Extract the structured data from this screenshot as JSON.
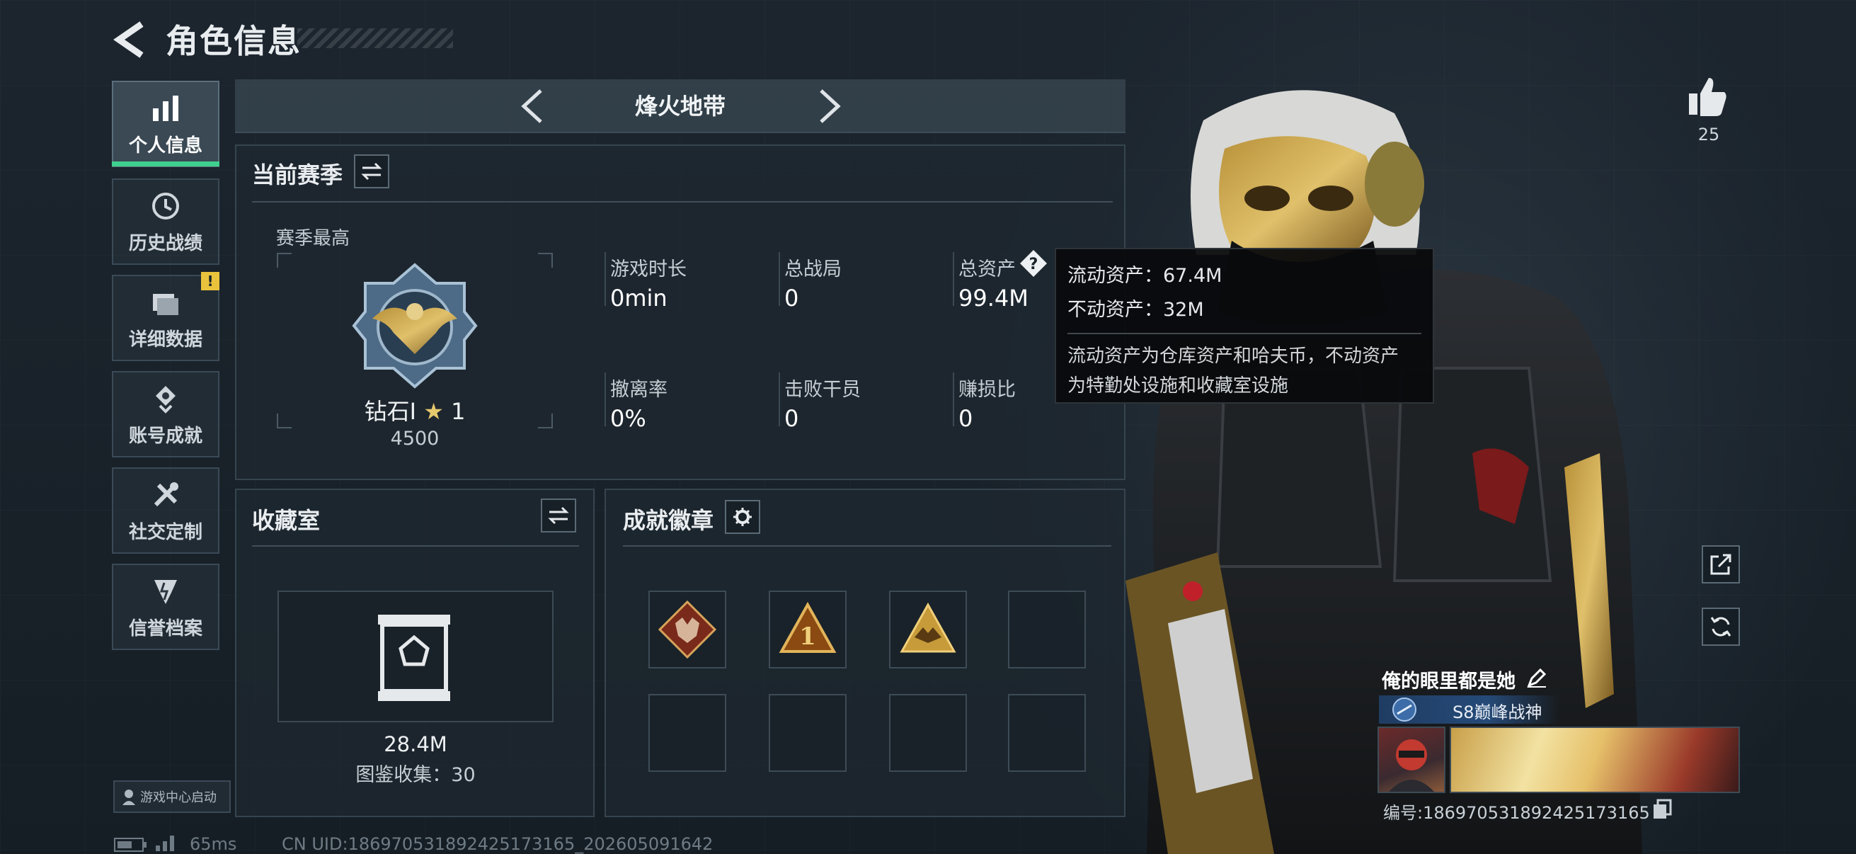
{
  "header": {
    "title": "角色信息"
  },
  "sidebar": {
    "items": [
      {
        "label": "个人信息",
        "icon": "bar-chart-icon",
        "active": true
      },
      {
        "label": "历史战绩",
        "icon": "history-clock-icon"
      },
      {
        "label": "详细数据",
        "icon": "folder-icon",
        "alert": "!"
      },
      {
        "label": "账号成就",
        "icon": "achievement-icon"
      },
      {
        "label": "社交定制",
        "icon": "tools-icon"
      },
      {
        "label": "信誉档案",
        "icon": "credit-icon"
      }
    ],
    "launch_label": "游戏中心启动"
  },
  "mode_bar": {
    "name": "烽火地带"
  },
  "season": {
    "title": "当前赛季",
    "best_label": "赛季最高",
    "rank_name": "钻石Ⅰ",
    "rank_stars": "1",
    "rank_points": "4500",
    "stats": [
      {
        "label": "游戏时长",
        "value": "0min"
      },
      {
        "label": "总战局",
        "value": "0"
      },
      {
        "label": "总资产",
        "value": "99.4M"
      },
      {
        "label": "撤离率",
        "value": "0%"
      },
      {
        "label": "击败干员",
        "value": "0"
      },
      {
        "label": "赚损比",
        "value": "0"
      }
    ]
  },
  "tooltip": {
    "liquid": "流动资产：67.4M",
    "fixed": "不动资产：32M",
    "desc_line1": "流动资产为仓库资产和哈夫币，不动资产",
    "desc_line2": "为特勤处设施和收藏室设施"
  },
  "collection": {
    "title": "收藏室",
    "value": "28.4M",
    "catalog": "图鉴收集：30"
  },
  "achievements": {
    "title": "成就徽章",
    "badges": [
      "wolf-badge-icon",
      "rank-one-badge-icon",
      "eagle-badge-icon"
    ]
  },
  "right": {
    "likes": "25",
    "player_name": "俺的眼里都是她",
    "rank_title": "S8巅峰战神",
    "uid": "编号:186970531892425173165"
  },
  "footer": {
    "ping": "65ms",
    "uid": "CN UID:186970531892425173165_202605091642"
  },
  "colors": {
    "accent": "#3ecf8e",
    "warning": "#e9c33c",
    "panel": "#1e2830"
  }
}
